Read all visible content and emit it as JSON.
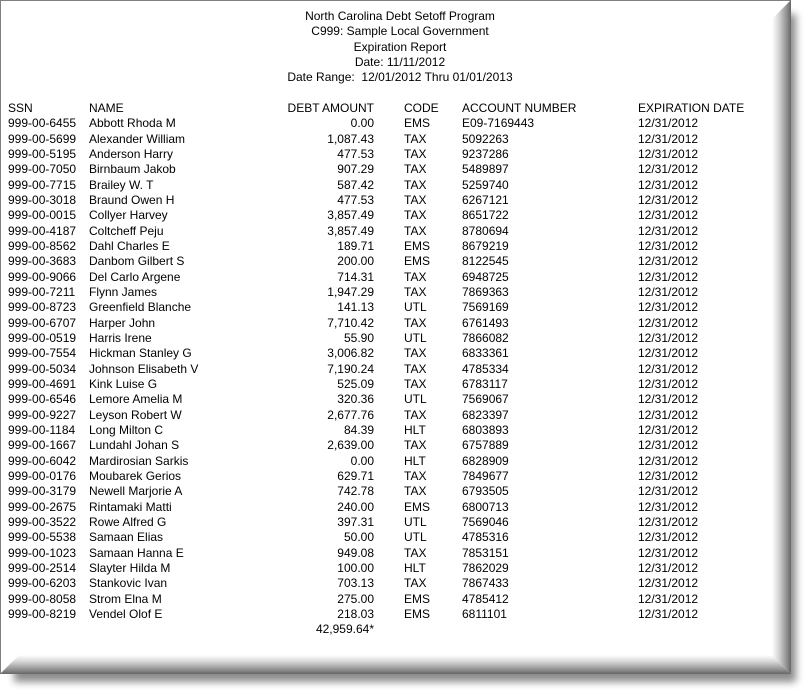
{
  "report": {
    "program": "North Carolina Debt Setoff Program",
    "entity": "C999: Sample Local Government",
    "title": "Expiration Report",
    "date": "Date: 11/11/2012",
    "date_range": "Date Range:  12/01/2012 Thru 01/01/2013"
  },
  "table": {
    "columns": {
      "ssn": "SSN",
      "name": "NAME",
      "amount": "DEBT AMOUNT",
      "code": "CODE",
      "account": "ACCOUNT NUMBER",
      "expiration": "EXPIRATION DATE"
    },
    "rows": [
      {
        "ssn": "999-00-6455",
        "name": "Abbott Rhoda M",
        "amount": "0.00",
        "code": "EMS",
        "account": "E09-7169443",
        "expiration": "12/31/2012"
      },
      {
        "ssn": "999-00-5699",
        "name": "Alexander William",
        "amount": "1,087.43",
        "code": "TAX",
        "account": "5092263",
        "expiration": "12/31/2012"
      },
      {
        "ssn": "999-00-5195",
        "name": "Anderson Harry",
        "amount": "477.53",
        "code": "TAX",
        "account": "9237286",
        "expiration": "12/31/2012"
      },
      {
        "ssn": "999-00-7050",
        "name": "Birnbaum Jakob",
        "amount": "907.29",
        "code": "TAX",
        "account": "5489897",
        "expiration": "12/31/2012"
      },
      {
        "ssn": "999-00-7715",
        "name": "Brailey W. T",
        "amount": "587.42",
        "code": "TAX",
        "account": "5259740",
        "expiration": "12/31/2012"
      },
      {
        "ssn": "999-00-3018",
        "name": "Braund Owen H",
        "amount": "477.53",
        "code": "TAX",
        "account": "6267121",
        "expiration": "12/31/2012"
      },
      {
        "ssn": "999-00-0015",
        "name": "Collyer Harvey",
        "amount": "3,857.49",
        "code": "TAX",
        "account": "8651722",
        "expiration": "12/31/2012"
      },
      {
        "ssn": "999-00-4187",
        "name": "Coltcheff Peju",
        "amount": "3,857.49",
        "code": "TAX",
        "account": "8780694",
        "expiration": "12/31/2012"
      },
      {
        "ssn": "999-00-8562",
        "name": "Dahl Charles E",
        "amount": "189.71",
        "code": "EMS",
        "account": "8679219",
        "expiration": "12/31/2012"
      },
      {
        "ssn": "999-00-3683",
        "name": "Danbom Gilbert S",
        "amount": "200.00",
        "code": "EMS",
        "account": "8122545",
        "expiration": "12/31/2012"
      },
      {
        "ssn": "999-00-9066",
        "name": "Del Carlo Argene",
        "amount": "714.31",
        "code": "TAX",
        "account": "6948725",
        "expiration": "12/31/2012"
      },
      {
        "ssn": "999-00-7211",
        "name": "Flynn James",
        "amount": "1,947.29",
        "code": "TAX",
        "account": "7869363",
        "expiration": "12/31/2012"
      },
      {
        "ssn": "999-00-8723",
        "name": "Greenfield Blanche",
        "amount": "141.13",
        "code": "UTL",
        "account": "7569169",
        "expiration": "12/31/2012"
      },
      {
        "ssn": "999-00-6707",
        "name": "Harper John",
        "amount": "7,710.42",
        "code": "TAX",
        "account": "6761493",
        "expiration": "12/31/2012"
      },
      {
        "ssn": "999-00-0519",
        "name": "Harris Irene",
        "amount": "55.90",
        "code": "UTL",
        "account": "7866082",
        "expiration": "12/31/2012"
      },
      {
        "ssn": "999-00-7554",
        "name": "Hickman Stanley G",
        "amount": "3,006.82",
        "code": "TAX",
        "account": "6833361",
        "expiration": "12/31/2012"
      },
      {
        "ssn": "999-00-5034",
        "name": "Johnson Elisabeth V",
        "amount": "7,190.24",
        "code": "TAX",
        "account": "4785334",
        "expiration": "12/31/2012"
      },
      {
        "ssn": "999-00-4691",
        "name": "Kink Luise G",
        "amount": "525.09",
        "code": "TAX",
        "account": "6783117",
        "expiration": "12/31/2012"
      },
      {
        "ssn": "999-00-6546",
        "name": "Lemore Amelia M",
        "amount": "320.36",
        "code": "UTL",
        "account": "7569067",
        "expiration": "12/31/2012"
      },
      {
        "ssn": "999-00-9227",
        "name": "Leyson Robert W",
        "amount": "2,677.76",
        "code": "TAX",
        "account": "6823397",
        "expiration": "12/31/2012"
      },
      {
        "ssn": "999-00-1184",
        "name": "Long Milton C",
        "amount": "84.39",
        "code": "HLT",
        "account": "6803893",
        "expiration": "12/31/2012"
      },
      {
        "ssn": "999-00-1667",
        "name": "Lundahl Johan S",
        "amount": "2,639.00",
        "code": "TAX",
        "account": "6757889",
        "expiration": "12/31/2012"
      },
      {
        "ssn": "999-00-6042",
        "name": "Mardirosian Sarkis",
        "amount": "0.00",
        "code": "HLT",
        "account": "6828909",
        "expiration": "12/31/2012"
      },
      {
        "ssn": "999-00-0176",
        "name": "Moubarek Gerios",
        "amount": "629.71",
        "code": "TAX",
        "account": "7849677",
        "expiration": "12/31/2012"
      },
      {
        "ssn": "999-00-3179",
        "name": "Newell Marjorie A",
        "amount": "742.78",
        "code": "TAX",
        "account": "6793505",
        "expiration": "12/31/2012"
      },
      {
        "ssn": "999-00-2675",
        "name": "Rintamaki Matti",
        "amount": "240.00",
        "code": "EMS",
        "account": "6800713",
        "expiration": "12/31/2012"
      },
      {
        "ssn": "999-00-3522",
        "name": "Rowe Alfred G",
        "amount": "397.31",
        "code": "UTL",
        "account": "7569046",
        "expiration": "12/31/2012"
      },
      {
        "ssn": "999-00-5538",
        "name": "Samaan Elias",
        "amount": "50.00",
        "code": "UTL",
        "account": "4785316",
        "expiration": "12/31/2012"
      },
      {
        "ssn": "999-00-1023",
        "name": "Samaan Hanna E",
        "amount": "949.08",
        "code": "TAX",
        "account": "7853151",
        "expiration": "12/31/2012"
      },
      {
        "ssn": "999-00-2514",
        "name": "Slayter Hilda M",
        "amount": "100.00",
        "code": "HLT",
        "account": "7862029",
        "expiration": "12/31/2012"
      },
      {
        "ssn": "999-00-6203",
        "name": "Stankovic Ivan",
        "amount": "703.13",
        "code": "TAX",
        "account": "7867433",
        "expiration": "12/31/2012"
      },
      {
        "ssn": "999-00-8058",
        "name": "Strom Elna M",
        "amount": "275.00",
        "code": "EMS",
        "account": "4785412",
        "expiration": "12/31/2012"
      },
      {
        "ssn": "999-00-8219",
        "name": "Vendel Olof E",
        "amount": "218.03",
        "code": "EMS",
        "account": "6811101",
        "expiration": "12/31/2012"
      }
    ],
    "total_amount": "42,959.64*"
  },
  "colors": {
    "text": "#000000",
    "page": "#ffffff",
    "frame_edge": "#808080"
  }
}
